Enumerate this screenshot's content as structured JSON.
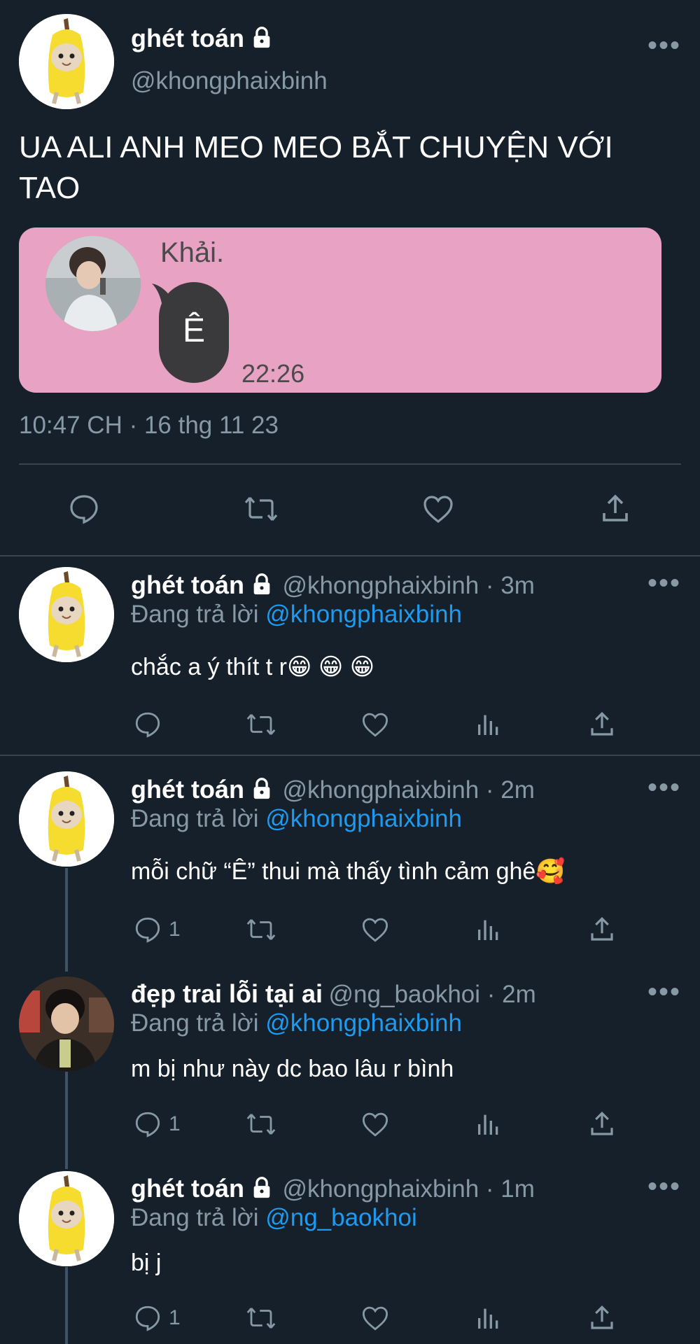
{
  "main_tweet": {
    "display_name": "ghét toán",
    "handle": "@khongphaixbinh",
    "text_line1": "UA ALI ANH MEO MEO BẮT CHUYỆN VỚI",
    "text_line2": "TAO",
    "embedded_image": {
      "name": "Khải.",
      "message": "Ê",
      "time": "22:26"
    },
    "timestamp": "10:47 CH · 16 thg 11 23"
  },
  "replies": [
    {
      "display_name": "ghét toán",
      "handle": "@khongphaixbinh · 3m",
      "replying_prefix": "Đang trả lời ",
      "replying_to": "@khongphaixbinh",
      "text": "chắc a ý thít t r😁 😁 😁",
      "reply_count": ""
    },
    {
      "display_name": "ghét toán",
      "handle": "@khongphaixbinh · 2m",
      "replying_prefix": "Đang trả lời ",
      "replying_to": "@khongphaixbinh",
      "text": "mỗi chữ “Ê” thui mà thấy tình cảm ghê🥰",
      "reply_count": "1"
    },
    {
      "display_name": "đẹp trai lỗi tại ai",
      "handle": "@ng_baokhoi · 2m",
      "replying_prefix": "Đang trả lời ",
      "replying_to": "@khongphaixbinh",
      "text": "m bị như này dc bao lâu r bình",
      "reply_count": "1"
    },
    {
      "display_name": "ghét toán",
      "handle": "@khongphaixbinh · 1m",
      "replying_prefix": "Đang trả lời ",
      "replying_to": "@ng_baokhoi",
      "text": "bị j",
      "reply_count": "1"
    }
  ],
  "more_label": "•••",
  "colors": {
    "background": "#15202b",
    "muted": "#8899a6",
    "link": "#1d9bf0",
    "embedded_bg": "#e7a2c4"
  }
}
